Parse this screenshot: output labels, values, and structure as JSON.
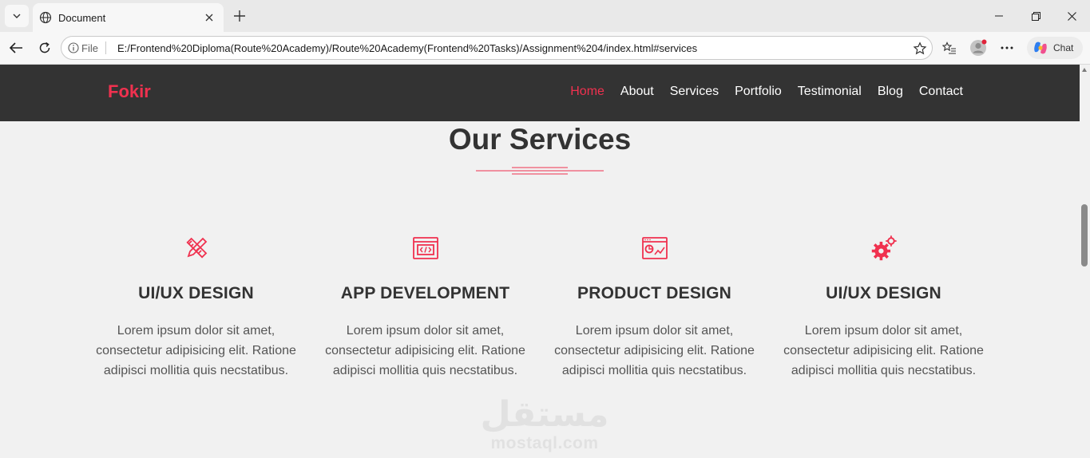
{
  "browser": {
    "tab_title": "Document",
    "file_label": "File",
    "url": "E:/Frontend%20Diploma(Route%20Academy)/Route%20Academy(Frontend%20Tasks)/Assignment%204/index.html#services",
    "chat_label": "Chat"
  },
  "site": {
    "brand": "Fokir",
    "nav": [
      {
        "label": "Home",
        "active": true
      },
      {
        "label": "About"
      },
      {
        "label": "Services"
      },
      {
        "label": "Portfolio"
      },
      {
        "label": "Testimonial"
      },
      {
        "label": "Blog"
      },
      {
        "label": "Contact"
      }
    ],
    "accent_color": "#f0314f",
    "navbar_color": "#333333"
  },
  "services": {
    "title": "Our Services",
    "items": [
      {
        "icon": "pencil-ruler-icon",
        "title": "UI/UX DESIGN",
        "text": "Lorem ipsum dolor sit amet, consectetur adipisicing elit. Ratione adipisci mollitia quis necstatibus."
      },
      {
        "icon": "code-window-icon",
        "title": "APP DEVELOPMENT",
        "text": "Lorem ipsum dolor sit amet, consectetur adipisicing elit. Ratione adipisci mollitia quis necstatibus."
      },
      {
        "icon": "chart-window-icon",
        "title": "PRODUCT DESIGN",
        "text": "Lorem ipsum dolor sit amet, consectetur adipisicing elit. Ratione adipisci mollitia quis necstatibus."
      },
      {
        "icon": "gears-icon",
        "title": "UI/UX DESIGN",
        "text": "Lorem ipsum dolor sit amet, consectetur adipisicing elit. Ratione adipisci mollitia quis necstatibus."
      }
    ]
  },
  "watermark": {
    "arabic": "مستقل",
    "latin": "mostaql.com"
  }
}
